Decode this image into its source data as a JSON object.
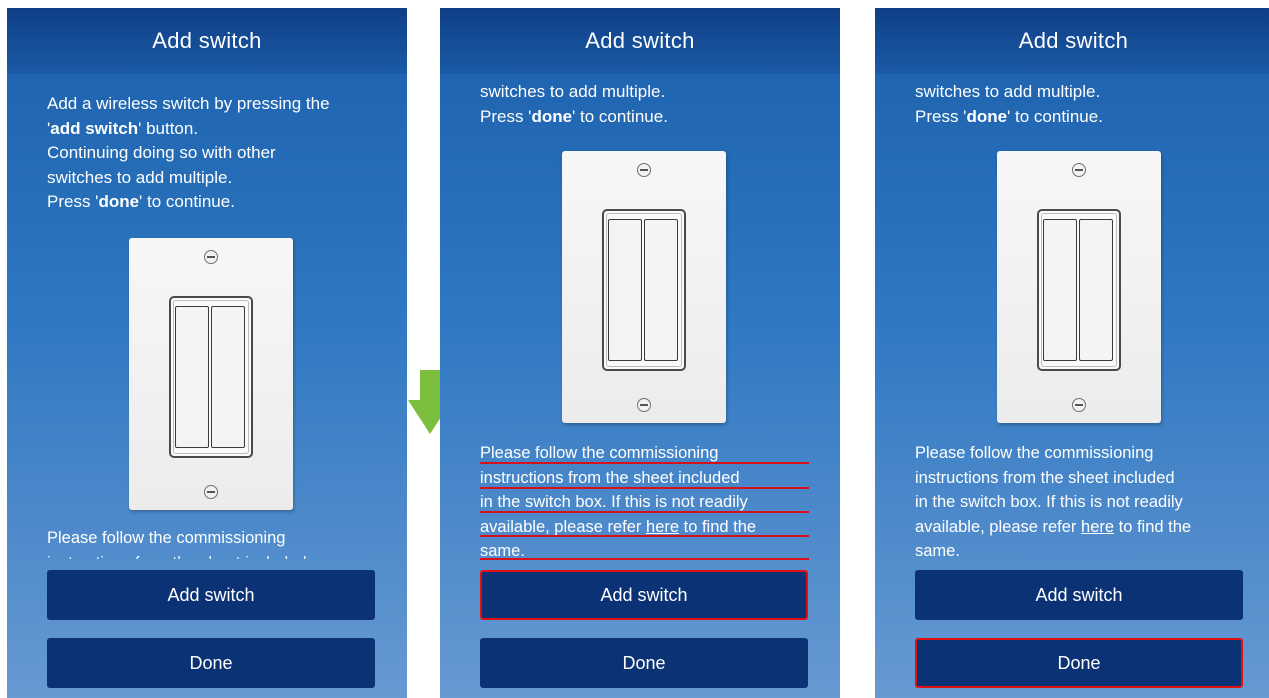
{
  "screens": [
    {
      "title": "Add switch",
      "intro_line1": "Add a wireless switch by pressing the",
      "intro_line2_pre": "'",
      "intro_line2_bold": "add switch",
      "intro_line2_post": "' button.",
      "intro_line3": "Continuing doing so with other",
      "intro_line4": "switches to add multiple.",
      "intro_line5_pre": "Press '",
      "intro_line5_bold": "done",
      "intro_line5_post": "' to continue.",
      "instructions_partial": "Please follow the commissioning",
      "add_switch_label": "Add switch",
      "done_label": "Done"
    },
    {
      "title": "Add switch",
      "intro_line1": "switches to add multiple.",
      "intro_line2_pre": "Press '",
      "intro_line2_bold": "done",
      "intro_line2_post": "' to continue.",
      "instr_line1": "Please follow the commissioning",
      "instr_line2": "instructions from the sheet included",
      "instr_line3": "in the switch box. If this is not readily",
      "instr_line4_pre": "available, please refer ",
      "instr_link": "here",
      "instr_line4_post": " to find the",
      "instr_line5": "same.",
      "add_switch_label": "Add switch",
      "done_label": "Done"
    },
    {
      "title": "Add switch",
      "intro_line1": "switches to add multiple.",
      "intro_line2_pre": "Press '",
      "intro_line2_bold": "done",
      "intro_line2_post": "' to continue.",
      "instr_line1": "Please follow the commissioning",
      "instr_line2": "instructions from the sheet included",
      "instr_line3": "in the switch box. If this is not readily",
      "instr_line4_pre": "available, please refer ",
      "instr_link": "here",
      "instr_line4_post": " to find the",
      "instr_line5": "same.",
      "add_switch_label": "Add switch",
      "done_label": "Done"
    }
  ],
  "colors": {
    "header": "#0e3f86",
    "button": "#0b3274",
    "highlight": "#e01010",
    "arrow": "#7cbf3f"
  },
  "icons": {
    "transition": "arrow-down-icon",
    "screw": "screw-icon"
  }
}
